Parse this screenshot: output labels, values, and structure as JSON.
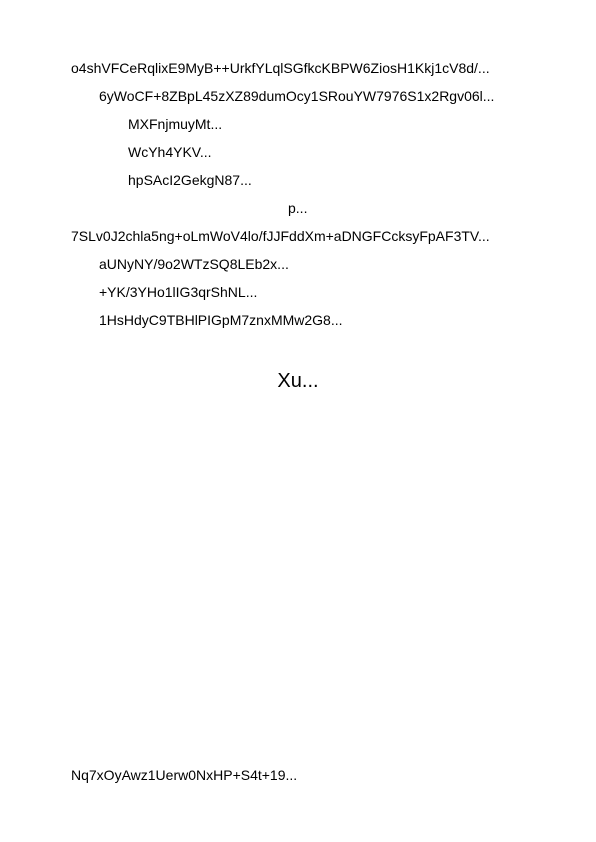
{
  "document": {
    "lines": [
      "o4shVFCeRqlixE9MyB++UrkfYLqlSGfkcKBPW6ZiosH1Kkj1cV8d/...",
      "6yWoCF+8ZBpL45zXZ89dumOcy1SRouYW7976S1x2Rgv06l...",
      "MXFnjmuyMt...",
      "WcYh4YKV...",
      "hpSAcI2GekgN87...",
      "p...",
      "7SLv0J2chla5ng+oLmWoV4lo/fJJFddXm+aDNGFCcksyFpAF3TV...",
      "aUNyNY/9o2WTzSQ8LEb2x...",
      "+YK/3YHo1lIG3qrShNL...",
      "1HsHdyC9TBHlPIGpM7znxMMw2G8..."
    ],
    "heading": "Xu...",
    "footer": "Nq7xOyAwz1Uerw0NxHP+S4t+19..."
  }
}
